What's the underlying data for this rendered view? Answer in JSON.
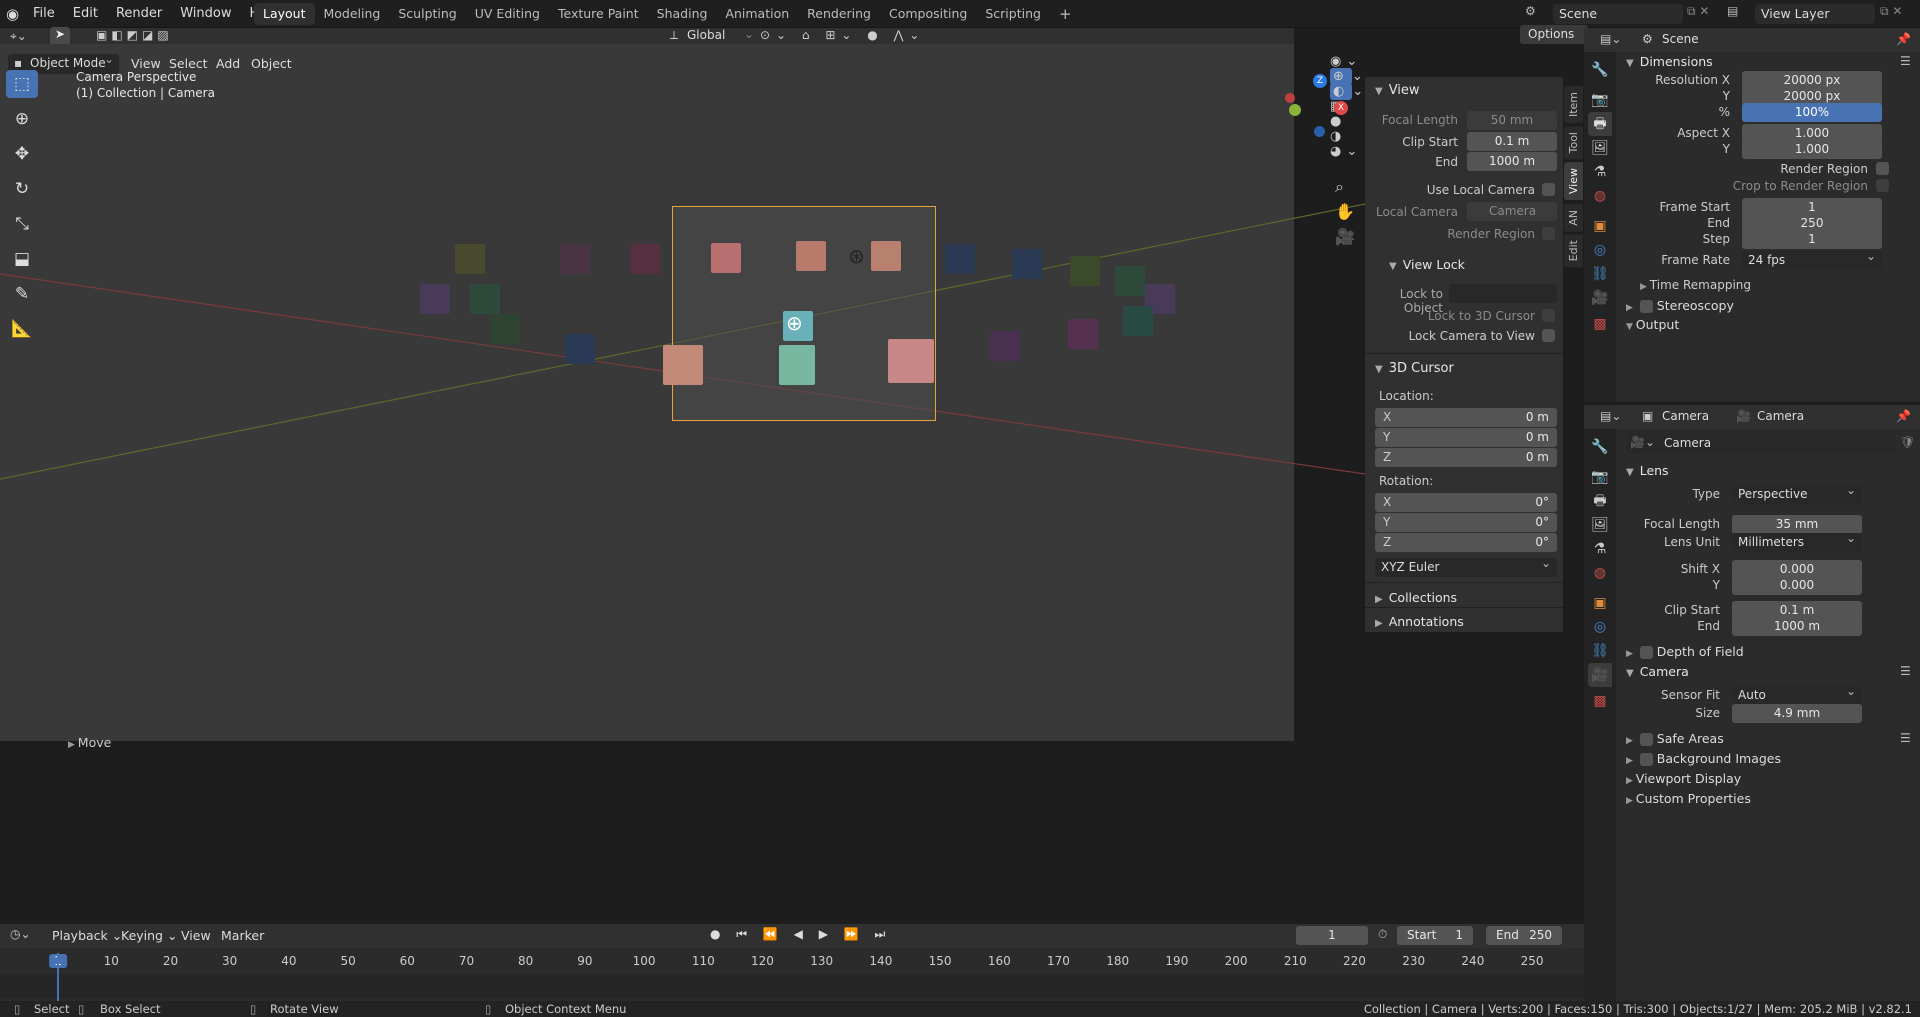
{
  "menu": {
    "file": "File",
    "edit": "Edit",
    "render": "Render",
    "window": "Window",
    "help": "Help"
  },
  "workspaces": [
    "Layout",
    "Modeling",
    "Sculpting",
    "UV Editing",
    "Texture Paint",
    "Shading",
    "Animation",
    "Rendering",
    "Compositing",
    "Scripting"
  ],
  "scene_name": "Scene",
  "view_layer": "View Layer",
  "header": {
    "mode": "Object Mode",
    "view": "View",
    "select": "Select",
    "add": "Add",
    "object": "Object",
    "orientation": "Global",
    "options": "Options"
  },
  "viewport": {
    "overlay_title": "Camera Perspective",
    "overlay_sub": "(1) Collection | Camera",
    "last_op": "Move"
  },
  "npanel": {
    "tabs": [
      "Item",
      "Tool",
      "View",
      "AN",
      "Edit"
    ],
    "view": {
      "title": "View",
      "focal_length_label": "Focal Length",
      "focal_length": "50 mm",
      "clip_start_label": "Clip Start",
      "clip_start": "0.1 m",
      "end_label": "End",
      "clip_end": "1000 m",
      "use_local_camera": "Use Local Camera",
      "local_camera_label": "Local Camera",
      "local_camera": "Camera",
      "render_region": "Render Region"
    },
    "view_lock": {
      "title": "View Lock",
      "lock_to_object": "Lock to Object",
      "lock_to_cursor": "Lock to 3D Cursor",
      "lock_camera": "Lock Camera to View"
    },
    "cursor": {
      "title": "3D Cursor",
      "location": "Location:",
      "x": "0 m",
      "y": "0 m",
      "z": "0 m",
      "rotation": "Rotation:",
      "rx": "0°",
      "ry": "0°",
      "rz": "0°",
      "mode": "XYZ Euler",
      "x_label": "X",
      "y_label": "Y",
      "z_label": "Z"
    },
    "collections": "Collections",
    "annotations": "Annotations"
  },
  "output_props": {
    "dimensions": "Dimensions",
    "res_x_label": "Resolution X",
    "res_x": "20000 px",
    "res_y_label": "Y",
    "res_y": "20000 px",
    "pct_label": "%",
    "pct": "100%",
    "aspect_x_label": "Aspect X",
    "aspect_x": "1.000",
    "aspect_y_label": "Y",
    "aspect_y": "1.000",
    "render_region": "Render Region",
    "crop": "Crop to Render Region",
    "frame_start_label": "Frame Start",
    "frame_start": "1",
    "end_label": "End",
    "frame_end": "250",
    "step_label": "Step",
    "step": "1",
    "frame_rate_label": "Frame Rate",
    "frame_rate": "24 fps",
    "time_remap": "Time Remapping",
    "stereoscopy": "Stereoscopy",
    "output": "Output"
  },
  "camera_props": {
    "breadcrumb_object": "Camera",
    "breadcrumb_data": "Camera",
    "datablock": "Camera",
    "lens": "Lens",
    "type_label": "Type",
    "type": "Perspective",
    "focal_label": "Focal Length",
    "focal": "35 mm",
    "lens_unit_label": "Lens Unit",
    "lens_unit": "Millimeters",
    "shift_x_label": "Shift X",
    "shift_x": "0.000",
    "shift_y_label": "Y",
    "shift_y": "0.000",
    "clip_start_label": "Clip Start",
    "clip_start": "0.1 m",
    "clip_end_label": "End",
    "clip_end": "1000 m",
    "dof": "Depth of Field",
    "camera": "Camera",
    "sensor_fit_label": "Sensor Fit",
    "sensor_fit": "Auto",
    "size_label": "Size",
    "size": "4.9 mm",
    "safe_areas": "Safe Areas",
    "bg_images": "Background Images",
    "viewport_display": "Viewport Display",
    "custom_props": "Custom Properties"
  },
  "timeline": {
    "playback": "Playback",
    "keying": "Keying",
    "view": "View",
    "marker": "Marker",
    "current": "1",
    "start_label": "Start",
    "start": "1",
    "end_label": "End",
    "end": "250",
    "ticks": [
      "1",
      "10",
      "20",
      "30",
      "40",
      "50",
      "60",
      "70",
      "80",
      "90",
      "100",
      "110",
      "120",
      "130",
      "140",
      "150",
      "160",
      "170",
      "180",
      "190",
      "200",
      "210",
      "220",
      "230",
      "240",
      "250"
    ]
  },
  "statusbar": {
    "select": "Select",
    "box_select": "Box Select",
    "rotate": "Rotate View",
    "context": "Object Context Menu",
    "info": "Collection | Camera | Verts:200 | Faces:150 | Tris:300 | Objects:1/27 | Mem: 205.2 MiB | v2.82.1"
  },
  "colors": {
    "accent": "#4772b3",
    "camera_frame": "#e8a33a",
    "x_axis": "#e04848",
    "y_axis": "#8ab33a",
    "z_axis": "#2c7be5"
  }
}
